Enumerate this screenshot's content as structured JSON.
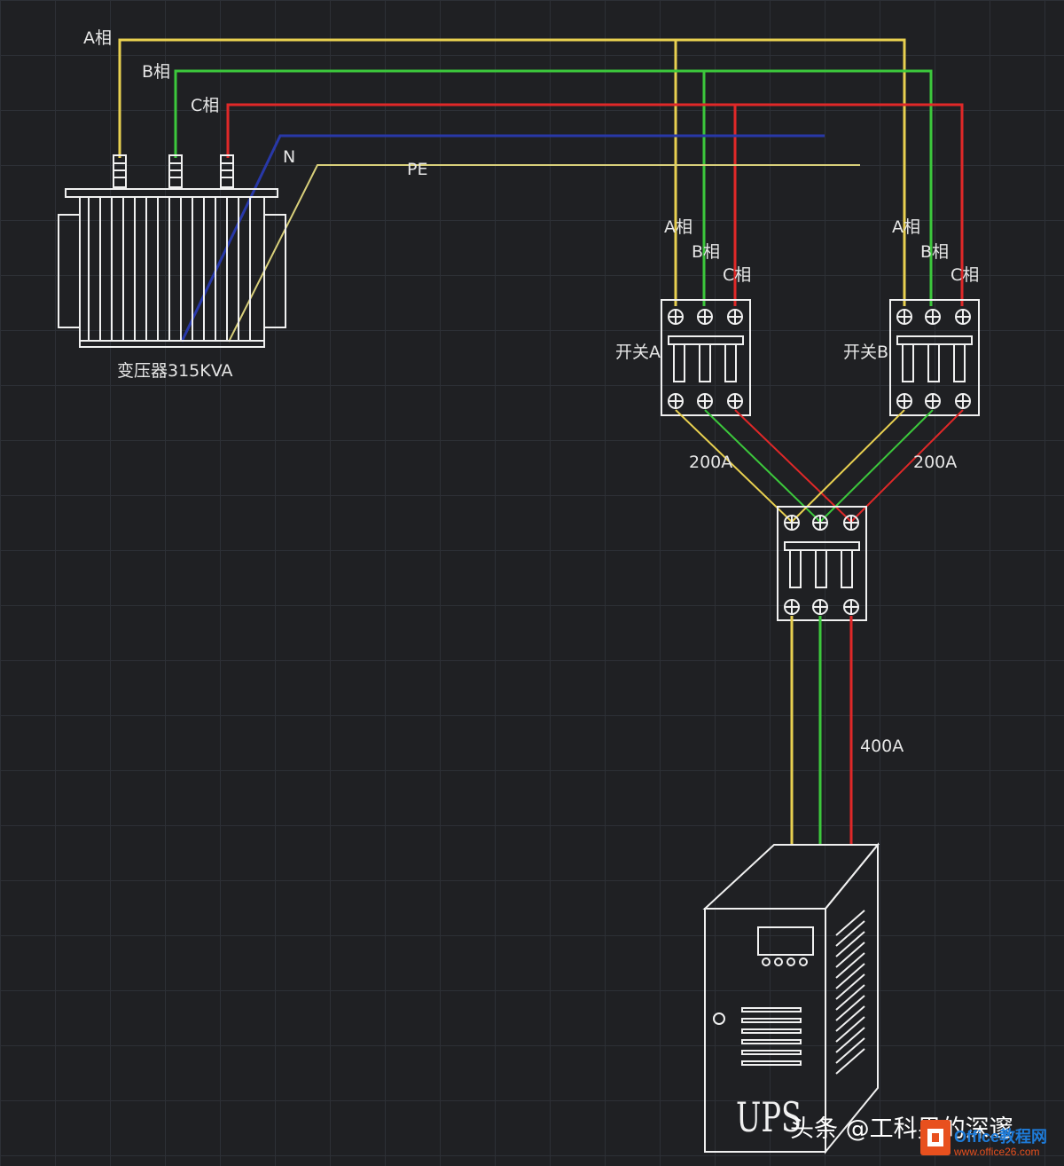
{
  "colors": {
    "phase_a": "#e8d050",
    "phase_b": "#3cc83c",
    "phase_c": "#e02828",
    "neutral": "#2838a8",
    "pe": "#d8cf7a",
    "equipment": "#f0f0f0",
    "background": "#1f2023",
    "grid": "#2d3036",
    "watermark_logo": "#e8501e"
  },
  "bus_labels": {
    "a": "A相",
    "b": "B相",
    "c": "C相",
    "n": "N",
    "pe": "PE"
  },
  "transformer": {
    "label": "变压器315KVA"
  },
  "switch_a": {
    "label": "开关A",
    "phase_a": "A相",
    "phase_b": "B相",
    "phase_c": "C相",
    "rating": "200A"
  },
  "switch_b": {
    "label": "开关B",
    "phase_a": "A相",
    "phase_b": "B相",
    "phase_c": "C相",
    "rating": "200A"
  },
  "main_feed": {
    "rating": "400A"
  },
  "ups": {
    "label": "UPS"
  },
  "watermark": {
    "author": "头条 @工科男的深邃",
    "site_name": "Office教程网",
    "site_url": "www.office26.com"
  }
}
